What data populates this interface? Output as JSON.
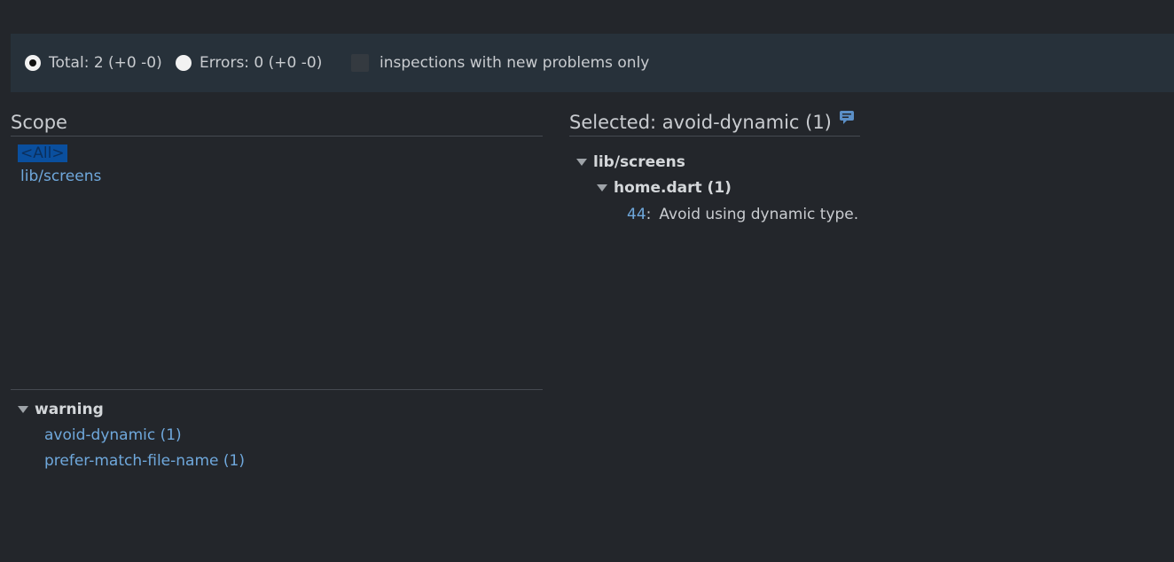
{
  "toolbar": {
    "total_label": "Total: 2 (+0 -0)",
    "errors_label": "Errors: 0 (+0 -0)",
    "new_problems_label": "inspections with new problems only"
  },
  "scope": {
    "title": "Scope",
    "items": [
      "<All>",
      "lib/screens"
    ]
  },
  "severity": {
    "group_label": "warning",
    "items": [
      "avoid-dynamic (1)",
      "prefer-match-file-name (1)"
    ]
  },
  "selected": {
    "title": "Selected: avoid-dynamic (1)",
    "folder": "lib/screens",
    "file": "home.dart (1)",
    "line": "44",
    "separator": ":",
    "message": "Avoid using dynamic type."
  },
  "icons": {
    "comment": "comment-icon",
    "expand": "triangle-down-icon"
  },
  "colors": {
    "background": "#23262b",
    "toolbar": "#27313a",
    "link": "#6fa8dc",
    "selection": "#0a4f9e"
  }
}
